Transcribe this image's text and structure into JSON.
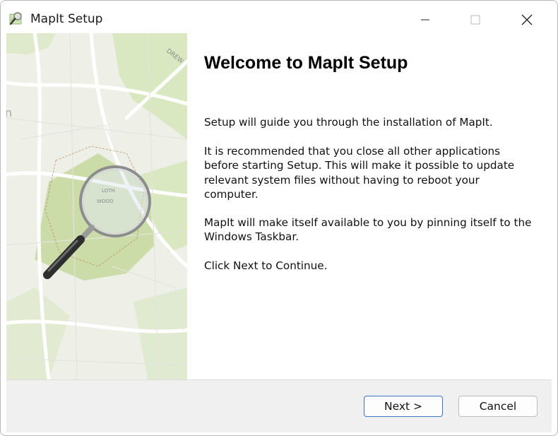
{
  "window": {
    "title": "MapIt Setup",
    "controls": {
      "minimize_icon": "minimize-icon",
      "maximize_icon": "maximize-icon",
      "close_icon": "close-icon"
    }
  },
  "side_panel": {
    "image": "map-with-magnifier",
    "map_label": "DREW"
  },
  "content": {
    "heading": "Welcome to MapIt Setup",
    "paragraphs": [
      "Setup will guide you through the installation of MapIt.",
      "It is recommended that you close all other applications\nbefore starting Setup.  This will make it possible to update\nrelevant system files without having to reboot your\ncomputer.",
      "MapIt will make itself available to you by pinning itself to the\nWindows Taskbar.",
      "Click Next to Continue."
    ]
  },
  "footer": {
    "next_label": "Next >",
    "cancel_label": "Cancel"
  },
  "colors": {
    "accent": "#3b73c7",
    "footer_bg": "#f0f0f0",
    "map_green": "#d5e6b8",
    "map_bg": "#eef0e8"
  }
}
